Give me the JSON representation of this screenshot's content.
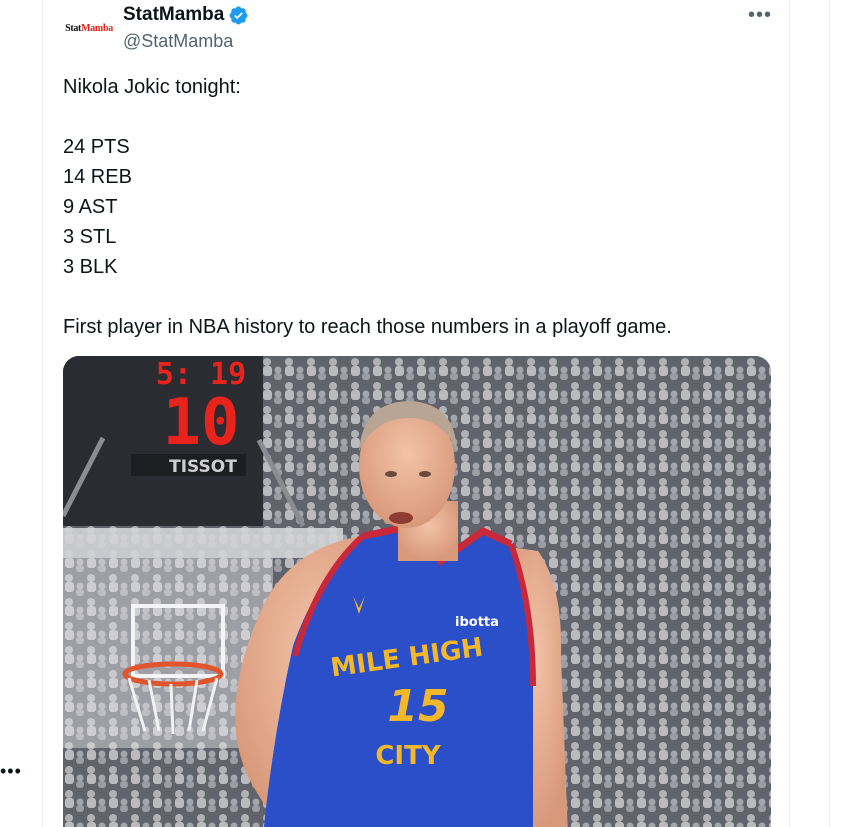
{
  "left_column": {
    "more_glyph": "•••"
  },
  "tweet": {
    "author": {
      "display_name": "StatMamba",
      "handle": "@StatMamba",
      "verified": true,
      "avatar_logo": {
        "part1": "Stat",
        "part2": "Mamba"
      }
    },
    "more_icon": "more-horizontal-icon",
    "text": {
      "intro": "Nikola Jokic tonight:",
      "stats": [
        "24 PTS",
        "14 REB",
        "9 AST",
        "3 STL",
        "3 BLK"
      ],
      "outro": "First player in NBA history to reach those numbers in a playoff game."
    },
    "media": {
      "scoreboard_time": "5: 19",
      "shot_clock": "10",
      "sponsor": "TISSOT",
      "jersey": {
        "arc_text": "MILE HIGH",
        "number": "15",
        "city_text": "CITY",
        "sponsor": "ibotta"
      }
    }
  },
  "colors": {
    "verified_blue": "#1d9bf0",
    "text_primary": "#0f1419",
    "text_secondary": "#536471",
    "jersey_blue": "#2a4fc9",
    "jersey_trim": "#c8283a",
    "jersey_gold": "#f3b72a",
    "clock_red": "#e8231c"
  }
}
